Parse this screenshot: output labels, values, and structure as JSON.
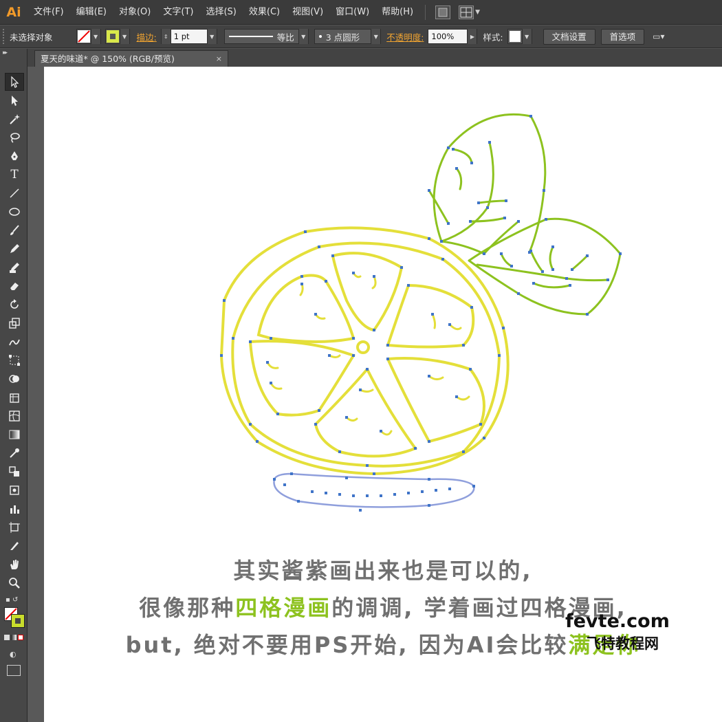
{
  "app": {
    "logo": "Ai"
  },
  "menu": [
    "文件(F)",
    "编辑(E)",
    "对象(O)",
    "文字(T)",
    "选择(S)",
    "效果(C)",
    "视图(V)",
    "窗口(W)",
    "帮助(H)"
  ],
  "controlbar": {
    "selection_label": "未选择对象",
    "stroke_link": "描边:",
    "stroke_weight": "1 pt",
    "stroke_profile": "等比",
    "brush": "3 点圆形",
    "opacity_link": "不透明度:",
    "opacity_value": "100%",
    "style_label": "样式:",
    "doc_setup_button": "文档设置",
    "preferences_button": "首选项",
    "fill_color": "#ffffff",
    "stroke_color": "#d4e157"
  },
  "document_tab": {
    "title": "夏天的味道* @ 150% (RGB/预览)",
    "close": "×"
  },
  "tools": [
    "selection-tool",
    "direct-selection-tool",
    "magic-wand-tool",
    "lasso-tool",
    "pen-tool",
    "type-tool",
    "line-tool",
    "ellipse-tool",
    "paintbrush-tool",
    "pencil-tool",
    "blob-brush-tool",
    "eraser-tool",
    "rotate-tool",
    "scale-tool",
    "warp-tool",
    "free-transform-tool",
    "shape-builder-tool",
    "symbol-sprayer-tool",
    "mesh-tool",
    "gradient-tool",
    "eyedropper-tool",
    "blend-tool",
    "live-paint-tool",
    "column-graph-tool",
    "artboard-tool",
    "slice-tool",
    "hand-tool",
    "zoom-tool"
  ],
  "caption": {
    "line1": "其实酱紫画出来也是可以的,",
    "line2_a": "很像那种",
    "line2_hl": "四格漫画",
    "line2_b": "的调调, 学着画过四格漫画,",
    "line3_a": "but, 绝对不要用PS开始, 因为AI会比较",
    "line3_hl": "满足你"
  },
  "watermark": {
    "domain": "fevte.com",
    "name": "飞特教程网"
  },
  "colors": {
    "lemon_outline": "#e4df3a",
    "leaf_outline": "#8dc21f",
    "anchor": "#3f74c8",
    "plate": "#8f9fdc",
    "highlight": "#8dc21f"
  }
}
